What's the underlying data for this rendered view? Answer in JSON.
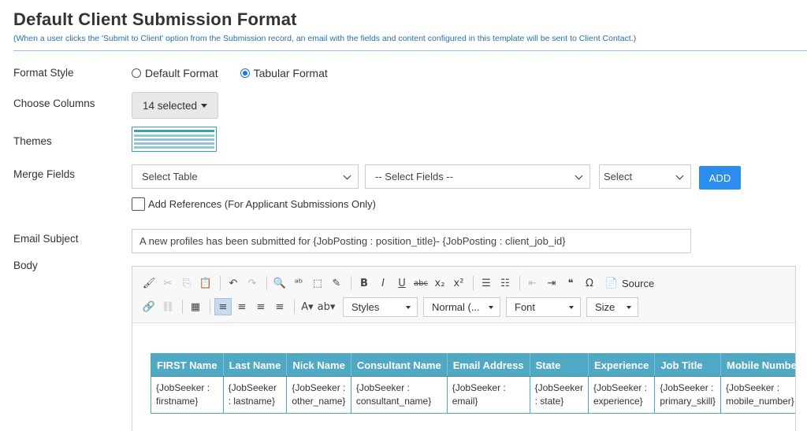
{
  "header": {
    "title": "Default Client Submission Format",
    "subtitle": "(When a user clicks the 'Submit to Client' option from the Submission record, an email with the fields and content configured in this template will be sent to Client Contact.)"
  },
  "labels": {
    "format_style": "Format Style",
    "choose_columns": "Choose Columns",
    "themes": "Themes",
    "merge_fields": "Merge Fields",
    "email_subject": "Email Subject",
    "body": "Body"
  },
  "format_style": {
    "options": [
      {
        "label": "Default Format",
        "checked": false
      },
      {
        "label": "Tabular Format",
        "checked": true
      }
    ]
  },
  "choose_columns": {
    "value": "14 selected"
  },
  "merge_fields": {
    "table_select": "Select Table",
    "fields_select": "-- Select Fields --",
    "third_select": "Select",
    "add_label": "ADD",
    "references_label": "Add References (For Applicant Submissions Only)"
  },
  "email_subject": {
    "value": "A new profiles has been submitted for  {JobPosting : position_title}- {JobPosting : client_job_id}"
  },
  "editor": {
    "toolbar_row1": [
      {
        "name": "paste-formatting-icon",
        "glyph": "🖌"
      },
      {
        "name": "cut-icon",
        "glyph": "✂",
        "dim": true
      },
      {
        "name": "copy-icon",
        "glyph": "⎘",
        "dim": true
      },
      {
        "name": "paste-icon",
        "glyph": "📋"
      },
      {
        "sep": true
      },
      {
        "name": "undo-icon",
        "glyph": "↶"
      },
      {
        "name": "redo-icon",
        "glyph": "↷",
        "dim": true
      },
      {
        "sep": true
      },
      {
        "name": "find-icon",
        "glyph": "🔍"
      },
      {
        "name": "replace-icon",
        "glyph": "ᵃᵇ"
      },
      {
        "name": "select-all-icon",
        "glyph": "⬚"
      },
      {
        "name": "spellcheck-icon",
        "glyph": "✎"
      },
      {
        "sep": true
      },
      {
        "name": "bold-icon",
        "glyph": "B"
      },
      {
        "name": "italic-icon",
        "glyph": "I"
      },
      {
        "name": "underline-icon",
        "glyph": "U"
      },
      {
        "name": "strikethrough-icon",
        "glyph": "abc"
      },
      {
        "name": "subscript-icon",
        "glyph": "x₂"
      },
      {
        "name": "superscript-icon",
        "glyph": "x²"
      },
      {
        "sep": true
      },
      {
        "name": "numbered-list-icon",
        "glyph": "☰"
      },
      {
        "name": "bulleted-list-icon",
        "glyph": "☷"
      },
      {
        "sep": true
      },
      {
        "name": "outdent-icon",
        "glyph": "⇤",
        "dim": true
      },
      {
        "name": "indent-icon",
        "glyph": "⇥"
      },
      {
        "name": "block-quote-icon",
        "glyph": "❝"
      },
      {
        "name": "special-char-icon",
        "glyph": "Ω"
      }
    ],
    "source_label": "Source",
    "toolbar_row2": [
      {
        "name": "link-icon",
        "glyph": "🔗"
      },
      {
        "name": "unlink-icon",
        "glyph": "⛓",
        "dim": true
      },
      {
        "sep": true
      },
      {
        "name": "table-icon",
        "glyph": "▦"
      },
      {
        "sep": true
      },
      {
        "name": "align-left-icon",
        "glyph": "≡",
        "active": true
      },
      {
        "name": "align-center-icon",
        "glyph": "≡"
      },
      {
        "name": "align-right-icon",
        "glyph": "≡"
      },
      {
        "name": "justify-icon",
        "glyph": "≡"
      },
      {
        "sep": true
      },
      {
        "name": "text-color-icon",
        "glyph": "A▾"
      },
      {
        "name": "bg-color-icon",
        "glyph": "ab▾"
      }
    ],
    "dropdowns": {
      "styles": "Styles",
      "format": "Normal (...",
      "font": "Font",
      "size": "Size"
    },
    "table": {
      "headers": [
        "FIRST Name",
        "Last Name",
        "Nick Name",
        "Consultant Name",
        "Email Address",
        "State",
        "Experience",
        "Job Title",
        "Mobile Number"
      ],
      "row": [
        "{JobSeeker :\nfirstname}",
        "{JobSeeker\n: lastname}",
        "{JobSeeker :\nother_name}",
        "{JobSeeker :\nconsultant_name}",
        "{JobSeeker :\nemail}",
        "{JobSeeker\n: state}",
        "{JobSeeker :\nexperience}",
        "{JobSeeker :\nprimary_skill}",
        "{JobSeeker :\nmobile_number}"
      ]
    }
  },
  "colors": {
    "accent": "#2b8ded",
    "table_header": "#4fa9c5",
    "subtitle": "#2a6fb3"
  }
}
